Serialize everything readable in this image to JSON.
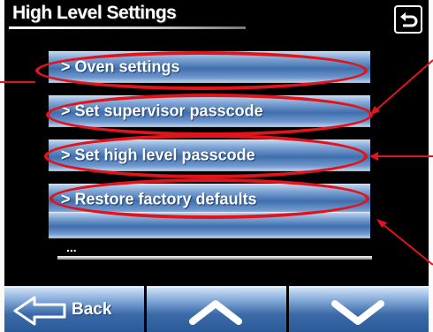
{
  "header": {
    "title": "High Level Settings",
    "back_icon": "return-arrow-icon"
  },
  "menu": {
    "items": [
      {
        "label": "> Oven settings"
      },
      {
        "label": "> Set supervisor passcode"
      },
      {
        "label": "> Set high level passcode"
      },
      {
        "label": "> Restore factory defaults"
      }
    ],
    "ellipsis": "..."
  },
  "bottom_bar": {
    "back_label": "Back",
    "back_icon": "arrow-left-icon",
    "up_icon": "chevron-up-icon",
    "down_icon": "chevron-down-icon"
  },
  "colors": {
    "screen_bg": "#000000",
    "button_blue": "#3f6fae",
    "annotation_red": "#e0141a"
  }
}
